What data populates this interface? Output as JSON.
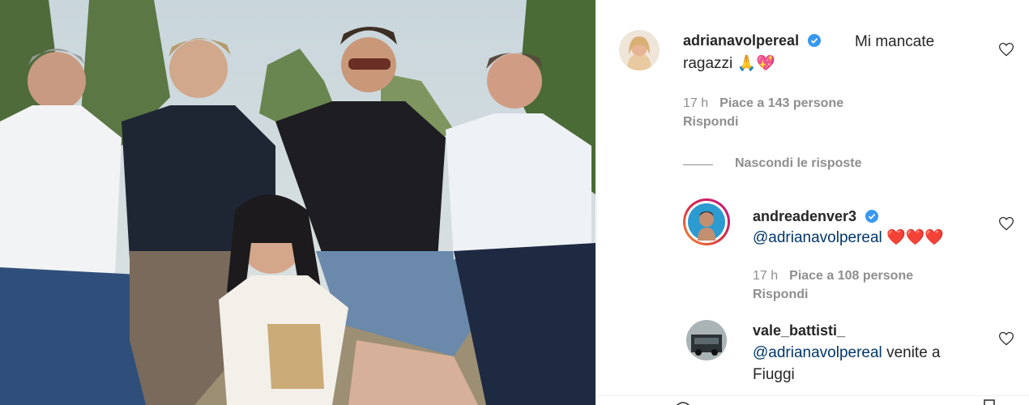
{
  "comments": [
    {
      "username": "adrianavolpereal",
      "verified": true,
      "text_line1": "Mi mancate",
      "text_line2": "ragazzi 🙏💖",
      "time": "17 h",
      "likes": "Piace a 143 persone",
      "reply": "Rispondi"
    },
    {
      "username": "andreadenver3",
      "verified": true,
      "mention": "@adrianavolpereal",
      "text": "❤️❤️❤️",
      "time": "17 h",
      "likes": "Piace a 108 persone",
      "reply": "Rispondi"
    },
    {
      "username": "vale_battisti_",
      "verified": false,
      "mention": "@adrianavolpereal",
      "text_line1": "venite a",
      "text_line2": "Fiuggi"
    }
  ],
  "hide_replies": "Nascondi le risposte",
  "colors": {
    "text": "#262626",
    "muted": "#8e8e8e",
    "mention": "#00376b",
    "verified": "#3897f0"
  },
  "icons": [
    "heart-icon",
    "verified-badge-icon"
  ]
}
